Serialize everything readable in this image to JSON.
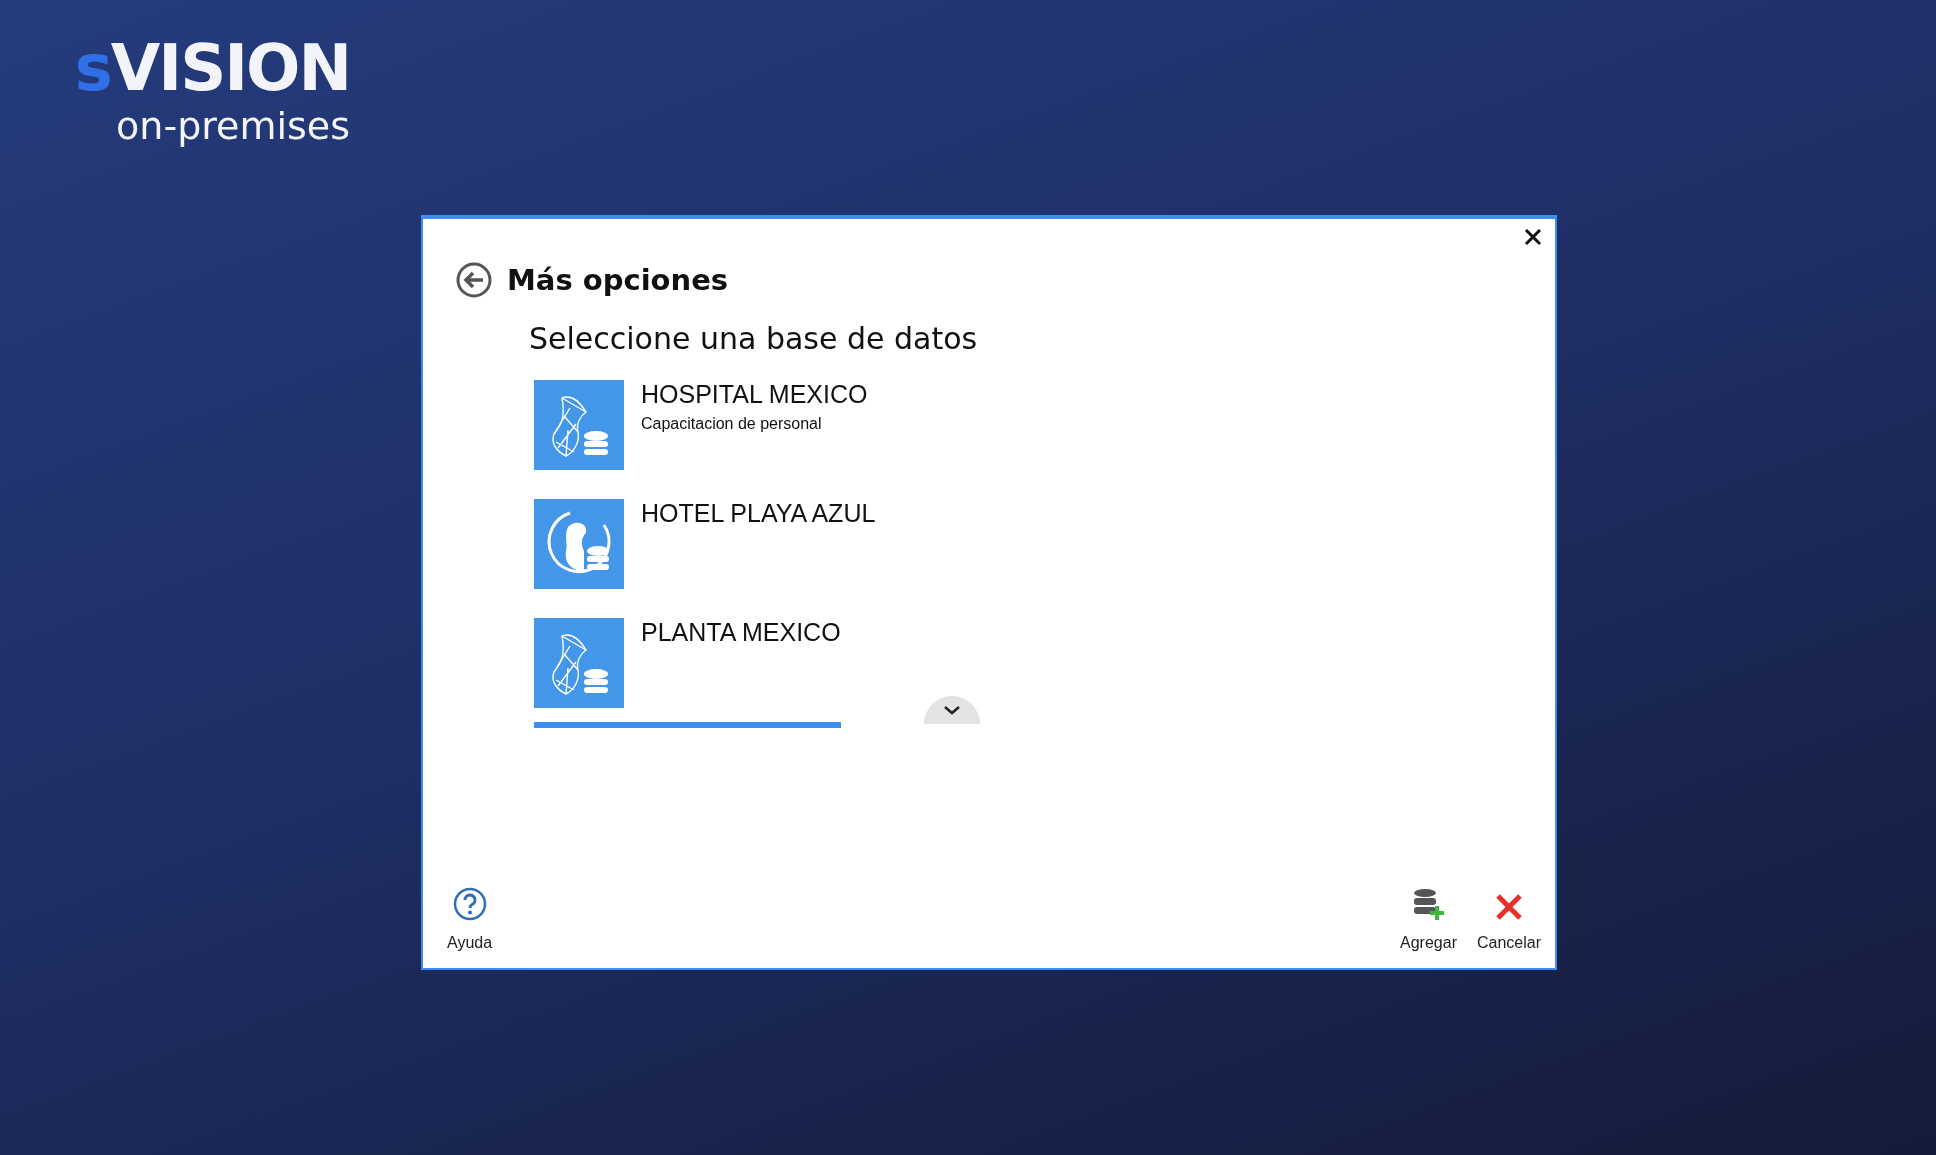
{
  "logo": {
    "accent": "s",
    "name": "VISION",
    "tagline": "on-premises"
  },
  "dialog": {
    "title": "Más opciones",
    "subtitle": "Seleccione una base de datos",
    "databases": [
      {
        "kind": "sqlserver",
        "name": "HOSPITAL MEXICO",
        "description": "Capacitacion de personal",
        "selected": false
      },
      {
        "kind": "firebird",
        "name": "HOTEL PLAYA AZUL",
        "selected": false
      },
      {
        "kind": "sqlserver",
        "name": "PLANTA MEXICO",
        "selected": true
      }
    ],
    "help": {
      "label": "Ayuda"
    },
    "actions": [
      {
        "kind": "add",
        "label": "Agregar"
      },
      {
        "kind": "cancel",
        "label": "Cancelar"
      }
    ]
  }
}
